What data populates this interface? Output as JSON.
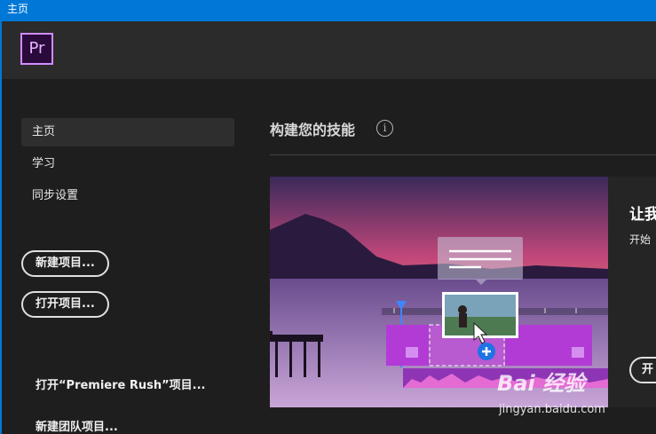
{
  "window": {
    "title": "主页"
  },
  "app": {
    "logo_text": "Pr"
  },
  "sidebar": {
    "items": [
      {
        "label": "主页",
        "active": true
      },
      {
        "label": "学习",
        "active": false
      },
      {
        "label": "同步设置",
        "active": false
      }
    ],
    "new_project_label": "新建项目...",
    "open_project_label": "打开项目...",
    "open_rush_label": "打开“Premiere Rush”项目...",
    "new_team_label": "新建团队项目..."
  },
  "main": {
    "section_title": "构建您的技能",
    "info_glyph": "i",
    "card": {
      "title": "让我",
      "subtitle": "开始",
      "button_label": "开"
    }
  },
  "watermark": {
    "brand": "Bai 经验",
    "url": "jingyan.baidu.com"
  },
  "colors": {
    "accent": "#0078d7",
    "logo_border": "#d18cff",
    "timeline_clip": "#b23bd6"
  }
}
